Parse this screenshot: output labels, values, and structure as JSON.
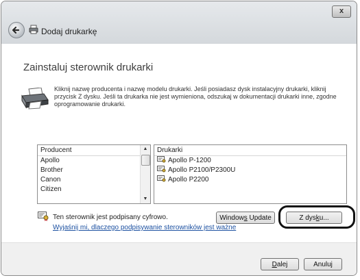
{
  "window": {
    "title": "Dodaj drukarkę",
    "close_label": "x"
  },
  "page": {
    "heading": "Zainstaluj sterownik drukarki",
    "description": "Kliknij nazwę producenta i nazwę modelu drukarki. Jeśli posiadasz dysk instalacyjny drukarki, kliknij przycisk Z dysku. Jeśli ta drukarka nie jest wymieniona, odszukaj w dokumentacji drukarki inne, zgodne oprogramowanie drukarki."
  },
  "producent_list": {
    "header": "Producent",
    "items": [
      "Apollo",
      "Brother",
      "Canon",
      "Citizen"
    ]
  },
  "drukarki_list": {
    "header": "Drukarki",
    "items": [
      "Apollo P-1200",
      "Apollo P2100/P2300U",
      "Apollo P2200"
    ]
  },
  "signature": {
    "status": "Ten sterownik jest podpisany cyfrowo.",
    "link": "Wyjaśnij mi, dlaczego podpisywanie sterowników jest ważne"
  },
  "buttons": {
    "windows_update_pre": "Window",
    "windows_update_key": "s",
    "windows_update_post": " Update",
    "z_dysku_pre": "Z dys",
    "z_dysku_key": "k",
    "z_dysku_post": "u...",
    "dalej_key": "D",
    "dalej_post": "alej",
    "anuluj": "Anuluj"
  },
  "icons": {
    "back": "back-arrow-icon",
    "printer": "printer-icon",
    "certificate": "certificate-icon"
  }
}
